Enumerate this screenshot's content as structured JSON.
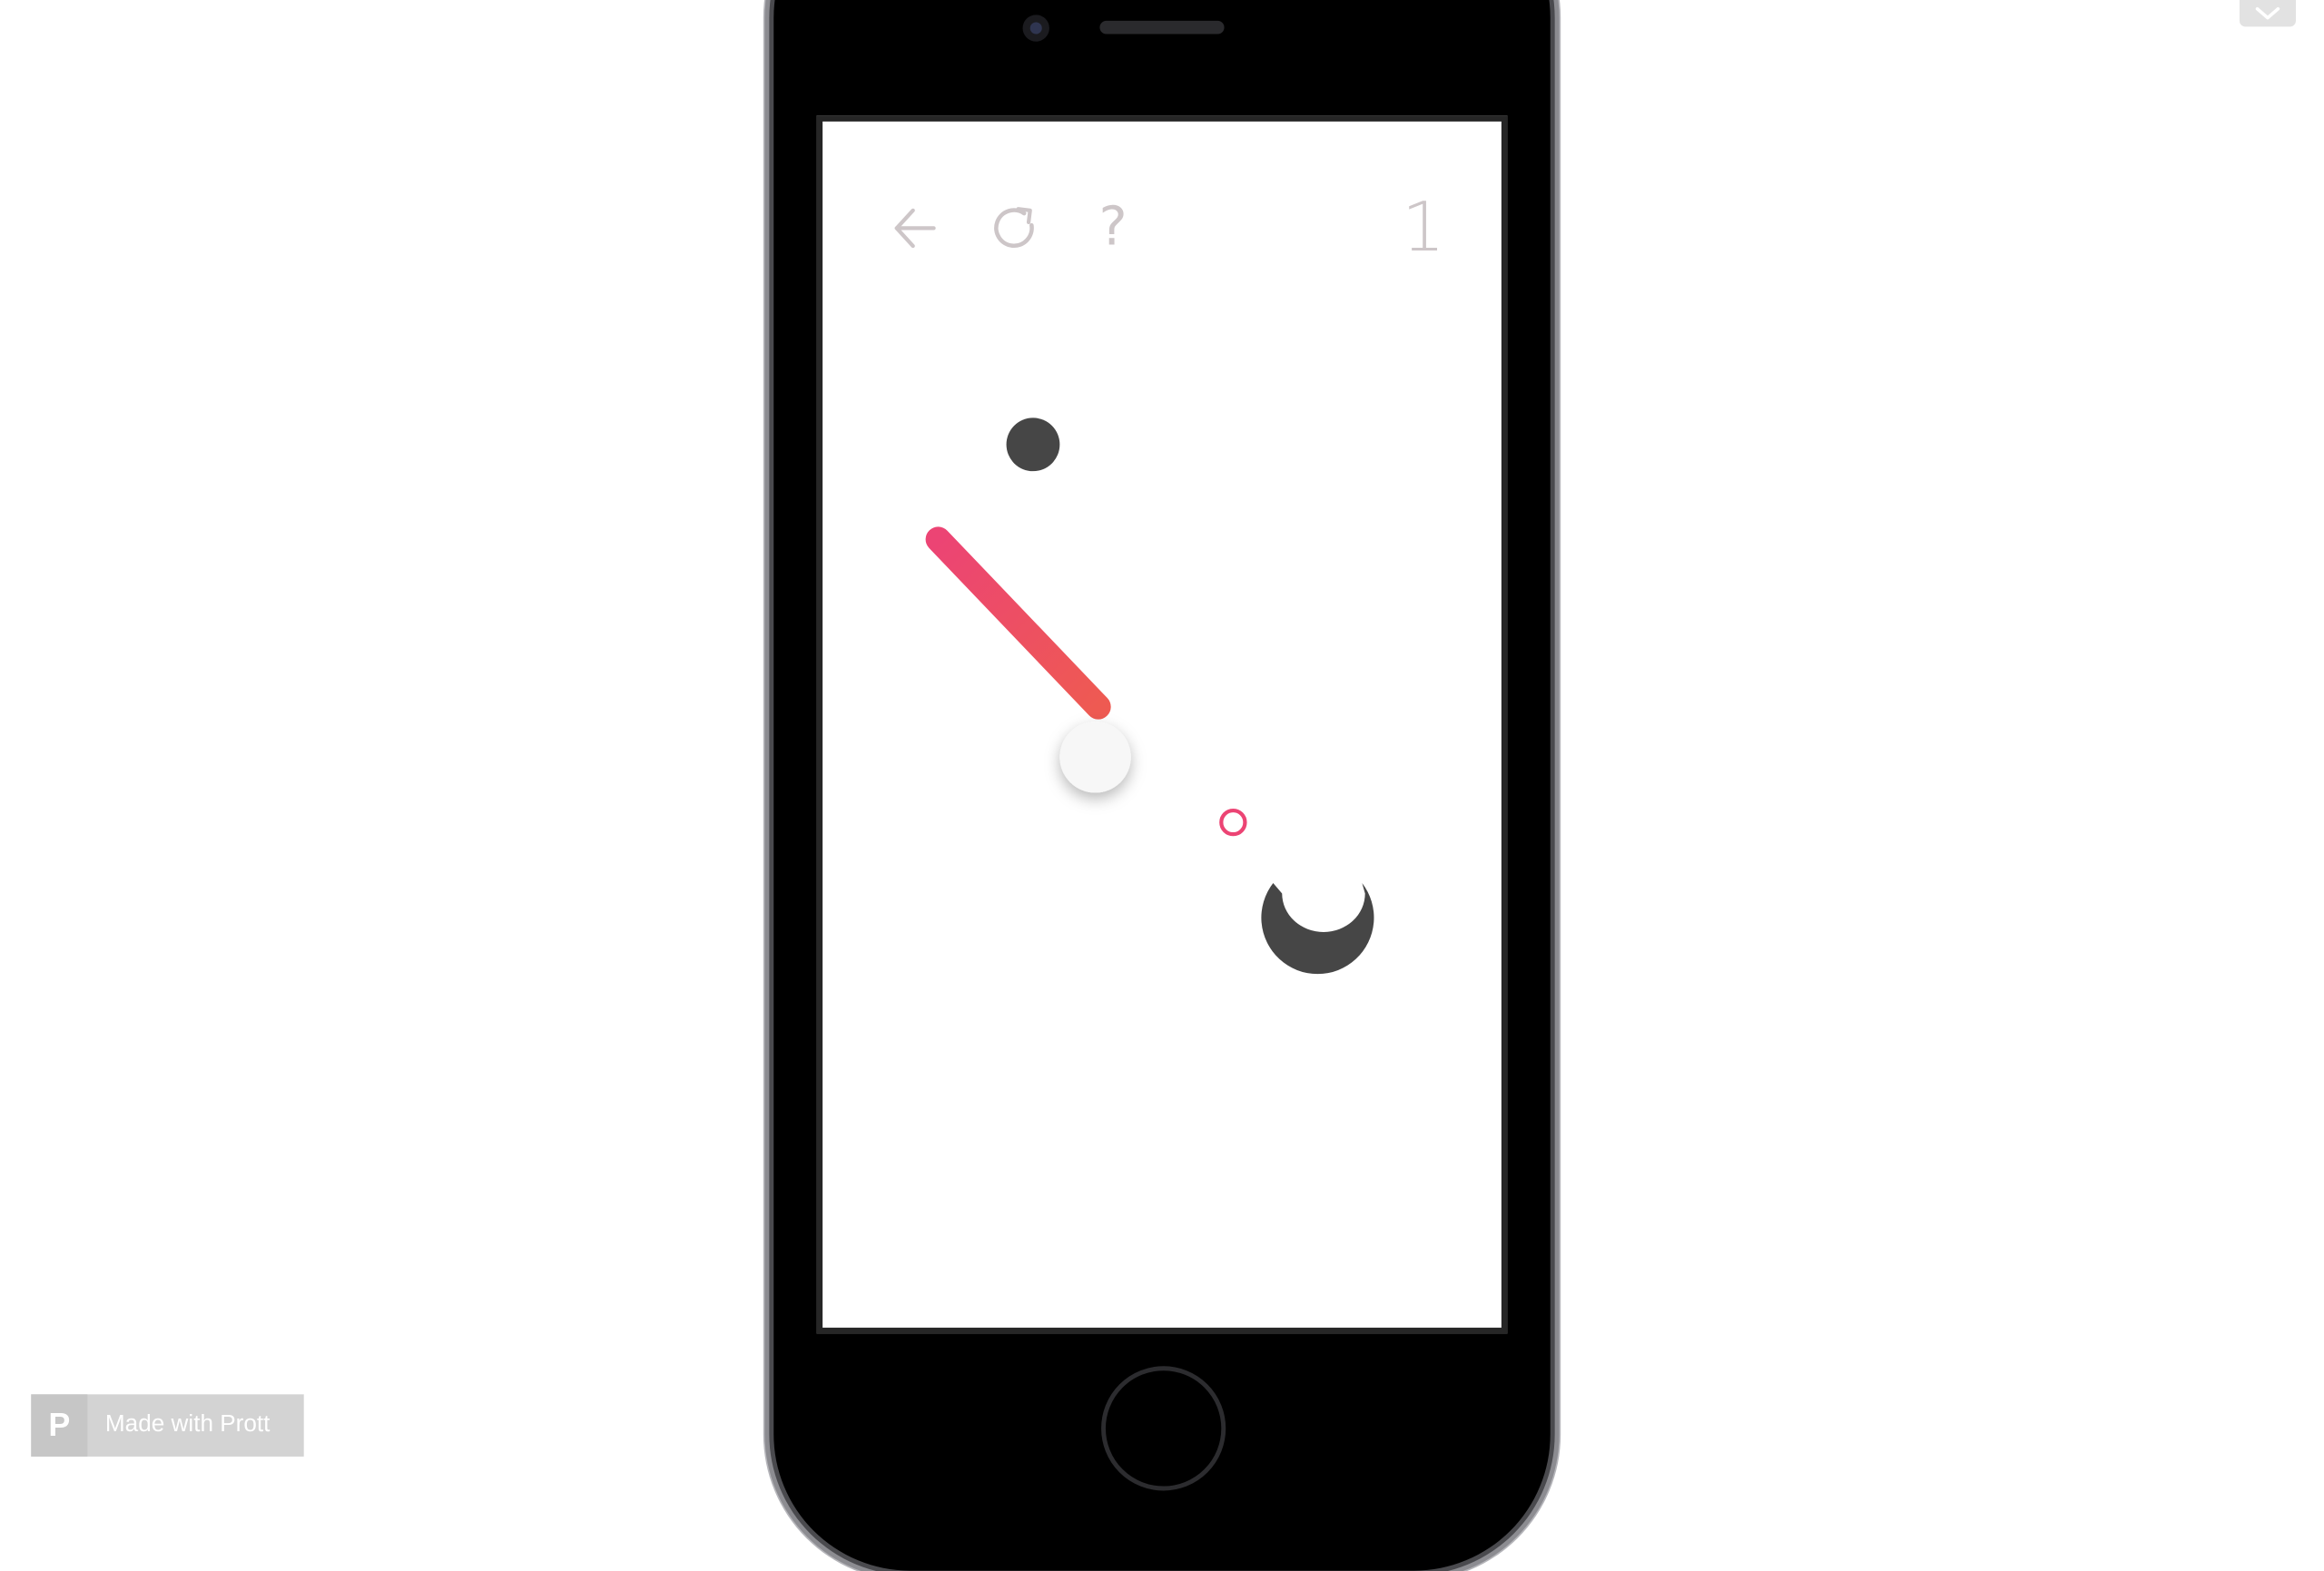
{
  "game": {
    "level_number": "1",
    "toolbar": {
      "back_icon": "arrow-left-icon",
      "restart_icon": "restart-icon",
      "help_label": "?"
    },
    "colors": {
      "accent": "#ec4474",
      "accent_end": "#ee5a52",
      "ink": "#464646",
      "toolbar": "#cdc6c8",
      "ball": "#f7f7f7"
    }
  },
  "badge": {
    "label": "Made with Prott",
    "logo": "P"
  },
  "ui": {
    "collapse_icon": "chevron-down-icon"
  }
}
